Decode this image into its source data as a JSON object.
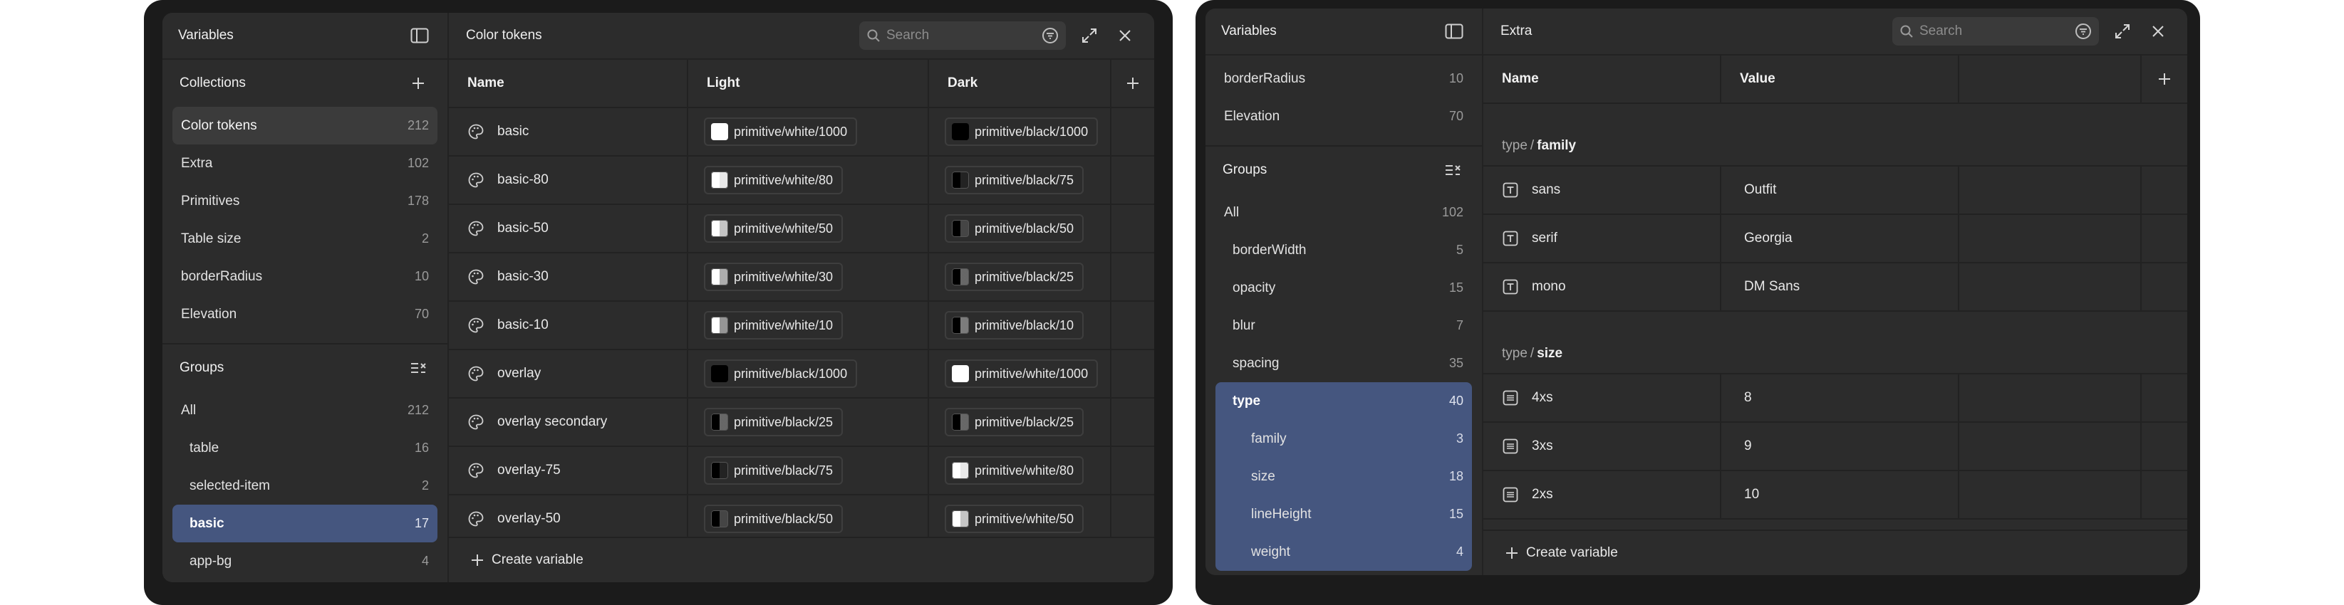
{
  "colors": {
    "frame_bg": "#1b1b1b",
    "window_bg": "#2c2c2c",
    "divider": "#222222",
    "selection": "#45567f",
    "active_row": "#3b3b3b",
    "text": "#e6e6e6",
    "muted": "#9a9a9a"
  },
  "left": {
    "sidebar": {
      "title": "Variables",
      "collections_label": "Collections",
      "collections": [
        {
          "label": "Color tokens",
          "count": "212"
        },
        {
          "label": "Extra",
          "count": "102"
        },
        {
          "label": "Primitives",
          "count": "178"
        },
        {
          "label": "Table size",
          "count": "2"
        },
        {
          "label": "borderRadius",
          "count": "10"
        },
        {
          "label": "Elevation",
          "count": "70"
        }
      ],
      "groups_label": "Groups",
      "groups": [
        {
          "label": "All",
          "count": "212"
        },
        {
          "label": "table",
          "count": "16"
        },
        {
          "label": "selected-item",
          "count": "2"
        },
        {
          "label": "basic",
          "count": "17"
        },
        {
          "label": "app-bg",
          "count": "4"
        }
      ]
    },
    "main": {
      "title": "Color tokens",
      "search_placeholder": "Search",
      "columns": [
        "Name",
        "Light",
        "Dark"
      ],
      "rows": [
        {
          "name": "basic",
          "light": "primitive/white/1000",
          "dark": "primitive/black/1000"
        },
        {
          "name": "basic-80",
          "light": "primitive/white/80",
          "dark": "primitive/black/75"
        },
        {
          "name": "basic-50",
          "light": "primitive/white/50",
          "dark": "primitive/black/50"
        },
        {
          "name": "basic-30",
          "light": "primitive/white/30",
          "dark": "primitive/black/25"
        },
        {
          "name": "basic-10",
          "light": "primitive/white/10",
          "dark": "primitive/black/10"
        },
        {
          "name": "overlay",
          "light": "primitive/black/1000",
          "dark": "primitive/white/1000"
        },
        {
          "name": "overlay secondary",
          "light": "primitive/black/25",
          "dark": "primitive/black/25"
        },
        {
          "name": "overlay-75",
          "light": "primitive/black/75",
          "dark": "primitive/white/80"
        },
        {
          "name": "overlay-50",
          "light": "primitive/black/50",
          "dark": "primitive/white/50"
        }
      ],
      "create_label": "Create variable"
    }
  },
  "right": {
    "sidebar": {
      "title": "Variables",
      "collections": [
        {
          "label": "borderRadius",
          "count": "10"
        },
        {
          "label": "Elevation",
          "count": "70"
        }
      ],
      "groups_label": "Groups",
      "groups": [
        {
          "label": "All",
          "count": "102"
        },
        {
          "label": "borderWidth",
          "count": "5"
        },
        {
          "label": "opacity",
          "count": "15"
        },
        {
          "label": "blur",
          "count": "7"
        },
        {
          "label": "spacing",
          "count": "35"
        },
        {
          "label": "type",
          "count": "40"
        },
        {
          "label": "family",
          "count": "3"
        },
        {
          "label": "size",
          "count": "18"
        },
        {
          "label": "lineHeight",
          "count": "15"
        },
        {
          "label": "weight",
          "count": "4"
        }
      ]
    },
    "main": {
      "title": "Extra",
      "search_placeholder": "Search",
      "columns": [
        "Name",
        "Value"
      ],
      "group1": {
        "parent": "type",
        "sep": "/",
        "child": "family"
      },
      "family_rows": [
        {
          "name": "sans",
          "value": "Outfit"
        },
        {
          "name": "serif",
          "value": "Georgia"
        },
        {
          "name": "mono",
          "value": "DM Sans"
        }
      ],
      "group2": {
        "parent": "type",
        "sep": "/",
        "child": "size"
      },
      "size_rows": [
        {
          "name": "4xs",
          "value": "8"
        },
        {
          "name": "3xs",
          "value": "9"
        },
        {
          "name": "2xs",
          "value": "10"
        }
      ],
      "create_label": "Create variable"
    }
  }
}
